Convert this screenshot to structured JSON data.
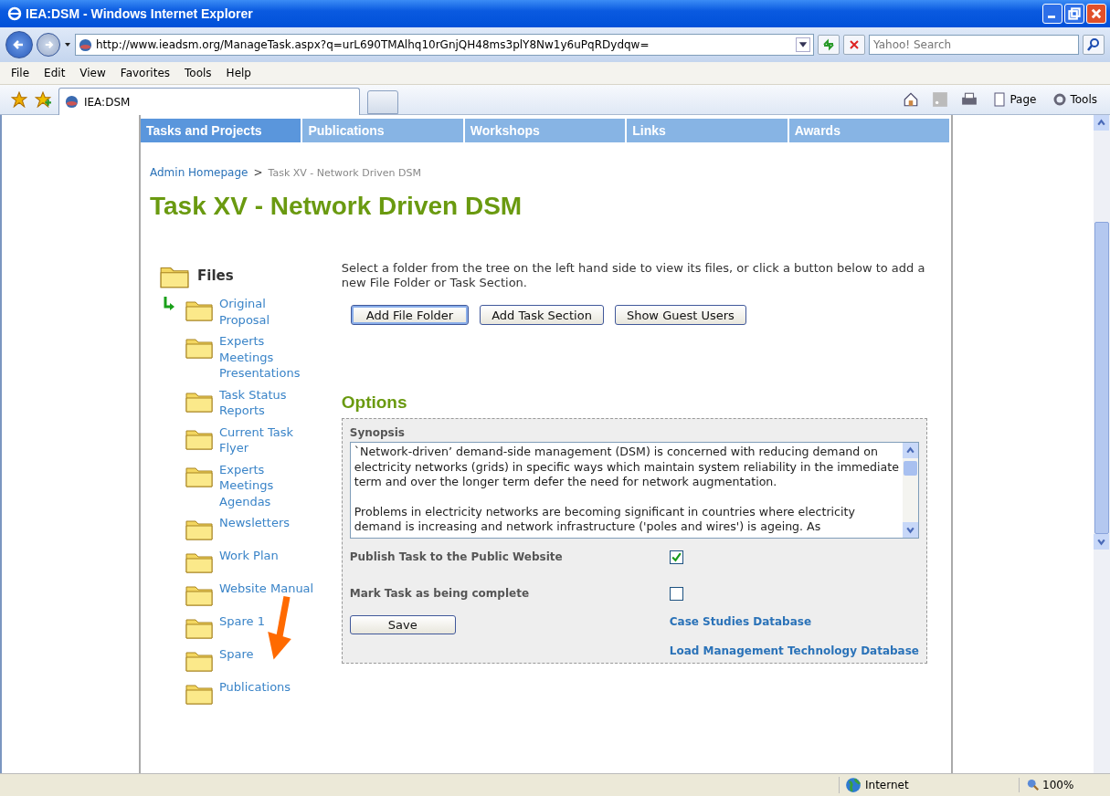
{
  "window": {
    "title": "IEA:DSM - Windows Internet Explorer"
  },
  "address_bar": {
    "url": "http://www.ieadsm.org/ManageTask.aspx?q=urL690TMAlhq10rGnjQH48ms3plY8Nw1y6uPqRDydqw=",
    "search_placeholder": "Yahoo! Search"
  },
  "menu_bar": [
    "File",
    "Edit",
    "View",
    "Favorites",
    "Tools",
    "Help"
  ],
  "tab": {
    "title": "IEA:DSM"
  },
  "command_bar": {
    "page": "Page",
    "tools": "Tools"
  },
  "nav": [
    {
      "label": "Tasks and Projects",
      "selected": true
    },
    {
      "label": "Publications",
      "selected": false
    },
    {
      "label": "Workshops",
      "selected": false
    },
    {
      "label": "Links",
      "selected": false
    },
    {
      "label": "Awards",
      "selected": false
    }
  ],
  "breadcrumb": {
    "link": "Admin Homepage",
    "separator": ">",
    "current": "Task XV - Network Driven DSM"
  },
  "heading": "Task XV - Network Driven DSM",
  "tree": {
    "label": "Files",
    "expanded": true,
    "children": [
      {
        "label": "Original Proposal"
      },
      {
        "label": "Experts Meetings Presentations"
      },
      {
        "label": "Task Status Reports"
      },
      {
        "label": "Current Task Flyer"
      },
      {
        "label": "Experts Meetings Agendas"
      },
      {
        "label": "Newsletters"
      },
      {
        "label": "Work Plan"
      },
      {
        "label": "Website Manual"
      },
      {
        "label": "Spare 1"
      },
      {
        "label": "Spare"
      },
      {
        "label": "Publications"
      }
    ]
  },
  "instructions": "Select a folder from the tree on the left hand side to view its files, or click a button below to add a new File Folder or Task Section.",
  "buttons": [
    {
      "label": "Add File Folder",
      "selected": true
    },
    {
      "label": "Add Task Section",
      "selected": false
    },
    {
      "label": "Show Guest Users",
      "selected": false
    }
  ],
  "options": {
    "title": "Options",
    "synopsis_label": "Synopsis",
    "synopsis": [
      "`Network-driven’ demand-side management (DSM) is concerned with reducing demand on electricity networks (grids) in specific ways which maintain system reliability in the immediate term and over the longer term defer the need for network augmentation.",
      "Problems in electricity networks are becoming significant in countries where electricity demand is increasing and network infrastructure ('poles and wires') is ageing.  As"
    ],
    "settings": [
      {
        "label": "Publish Task to the Public Website",
        "checked": true
      },
      {
        "label": "Mark Task as being complete",
        "checked": false
      }
    ],
    "save": "Save",
    "links": [
      "Case Studies Database",
      "Load Management Technology Database"
    ]
  },
  "status_bar": {
    "zone": "Internet",
    "zoom": "100%"
  }
}
